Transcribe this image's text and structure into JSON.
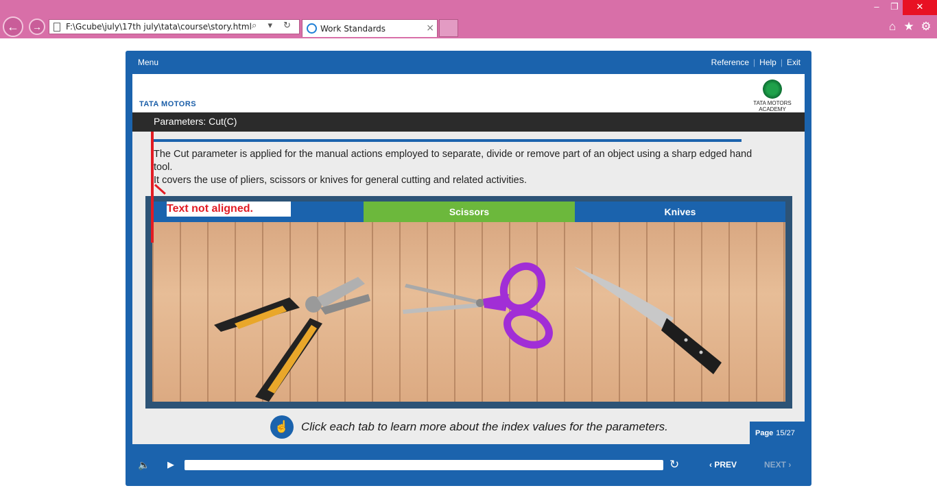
{
  "browser": {
    "address": "F:\\Gcube\\july\\17th july\\tata\\course\\story.html",
    "tab_title": "Work Standards",
    "address_tools": "⌕ ▾ ↻",
    "tab_close": "×",
    "win_min": "–",
    "win_max": "❐",
    "win_close": "✕",
    "back": "←",
    "forward": "→",
    "home": "⌂",
    "favorites": "★",
    "tools": "⚙"
  },
  "player": {
    "menu_label": "Menu",
    "reference_label": "Reference",
    "help_label": "Help",
    "exit_label": "Exit",
    "sep": "|"
  },
  "slide": {
    "brand": "TATA MOTORS",
    "academy": "TATA MOTORS ACADEMY",
    "title": "Parameters: Cut(C)",
    "paragraph1": "The Cut parameter is applied for the manual actions employed to separate, divide or remove part of an object using a sharp edged hand tool.",
    "paragraph2": " It covers the use of pliers, scissors or knives for general cutting and related activities.",
    "tabs": [
      "",
      "Scissors",
      "Knives"
    ],
    "annotation": "Text not aligned.",
    "instruction": "Click each tab to learn more about the index values for the parameters.",
    "page_label": "Page",
    "page_value": "15/27"
  },
  "controls": {
    "volume": "🔈",
    "play": "▶",
    "replay": "↻",
    "prev_label": "‹  PREV",
    "next_label": "NEXT  ›"
  },
  "colors": {
    "chrome": "#d86fa8",
    "player_blue": "#1b63ad",
    "active_tab": "#6cb83c",
    "annotation_red": "#e21b23"
  }
}
